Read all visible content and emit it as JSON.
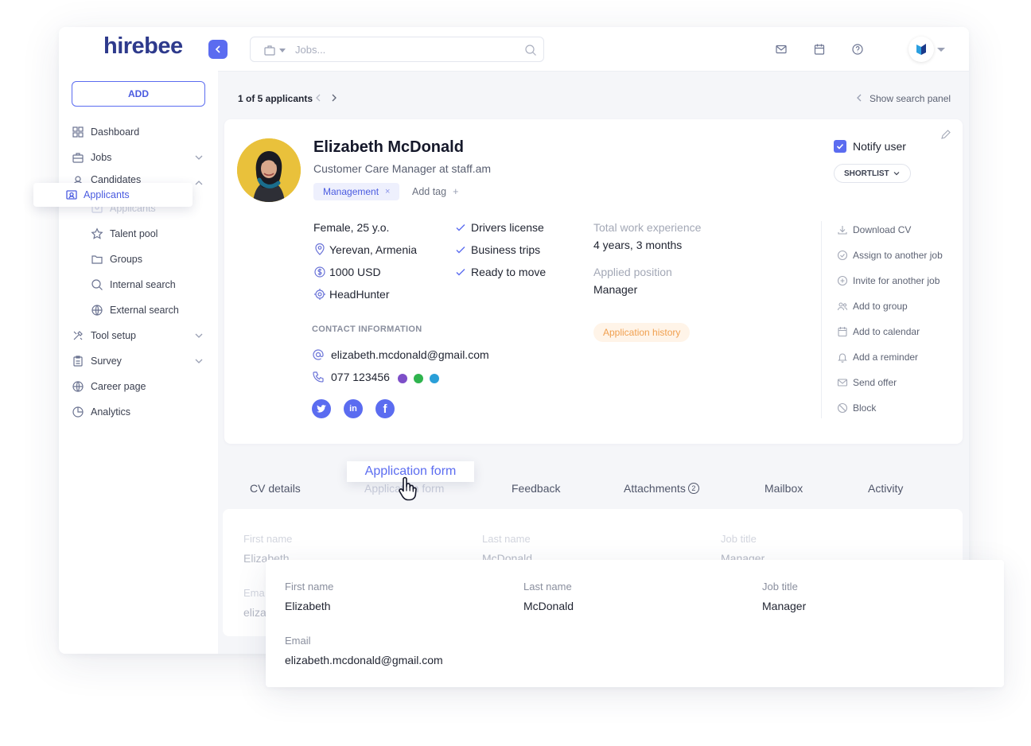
{
  "app": {
    "logo": "hirebee"
  },
  "sidebar": {
    "add_label": "ADD",
    "items": [
      {
        "label": "Dashboard"
      },
      {
        "label": "Jobs"
      },
      {
        "label": "Candidates"
      },
      {
        "label": "Applicants"
      },
      {
        "label": "Talent pool"
      },
      {
        "label": "Groups"
      },
      {
        "label": "Internal search"
      },
      {
        "label": "External search"
      },
      {
        "label": "Tool setup"
      },
      {
        "label": "Survey"
      },
      {
        "label": "Career page"
      },
      {
        "label": "Analytics"
      }
    ],
    "floating_item": "Applicants"
  },
  "topbar": {
    "search_placeholder": "Jobs..."
  },
  "breadcrumb": {
    "counter": "1 of 5 applicants",
    "search_panel": "Show search panel"
  },
  "profile": {
    "name": "Elizabeth McDonald",
    "role": "Customer Care Manager at staff.am",
    "tag": "Management",
    "tag_remove": "×",
    "add_tag": "Add tag",
    "add_tag_plus": "+",
    "gender_age": "Female, 25 y.o.",
    "location": "Yerevan, Armenia",
    "salary": "1000 USD",
    "source": "HeadHunter",
    "checks": [
      "Drivers license",
      "Business trips",
      "Ready to move"
    ],
    "experience_label": "Total work experience",
    "experience_value": "4 years, 3 months",
    "position_label": "Applied position",
    "position_value": "Manager",
    "contact_label": "CONTACT INFORMATION",
    "email": "elizabeth.mcdonald@gmail.com",
    "phone": "077 123456",
    "application_history": "Application history",
    "notify_label": "Notify user",
    "shortlist_label": "SHORTLIST"
  },
  "actions": [
    {
      "label": "Download CV"
    },
    {
      "label": "Assign to another job"
    },
    {
      "label": "Invite for another job"
    },
    {
      "label": "Add to group"
    },
    {
      "label": "Add to calendar"
    },
    {
      "label": "Add a reminder"
    },
    {
      "label": "Send offer"
    },
    {
      "label": "Block"
    }
  ],
  "tabs": {
    "cv": "CV details",
    "application_form": "Application form",
    "feedback": "Feedback",
    "attachments": "Attachments",
    "attachments_count": "2",
    "mailbox": "Mailbox",
    "activity": "Activity"
  },
  "form": {
    "first_name_label": "First name",
    "first_name": "Elizabeth",
    "last_name_label": "Last name",
    "last_name": "McDonald",
    "job_title_label": "Job title",
    "job_title": "Manager",
    "email_label": "Email",
    "email": "elizabeth.mcdonald@gmail.com",
    "ghost_email_label": "Ema",
    "ghost_email_value": "eliza"
  },
  "colors": {
    "accent": "#5b6cf0",
    "orange": "#f0a050",
    "background": "#f5f6f9"
  }
}
